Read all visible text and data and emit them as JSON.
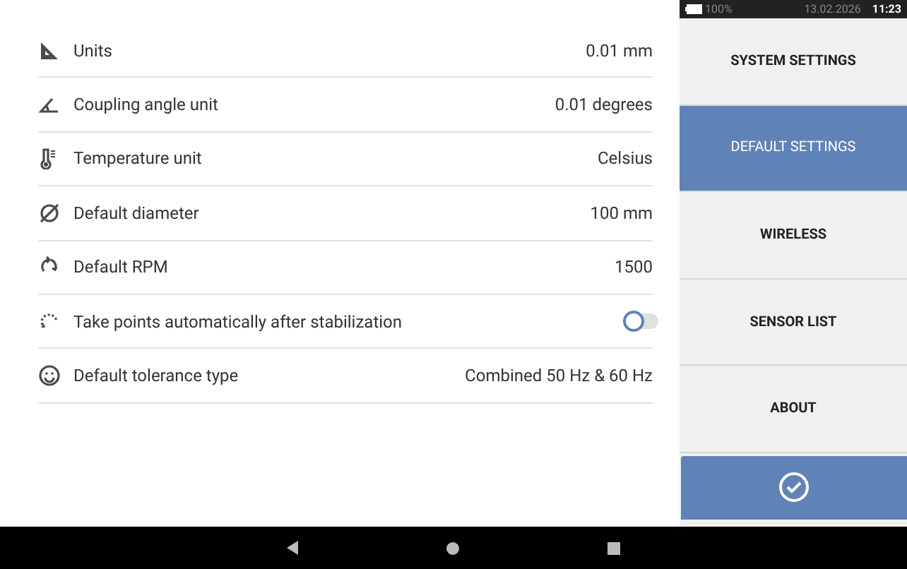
{
  "settings": [
    {
      "kind": "value",
      "label": "Units",
      "value": "0.01 mm"
    },
    {
      "kind": "value",
      "label": "Coupling angle unit",
      "value": "0.01 degrees"
    },
    {
      "kind": "value",
      "label": "Temperature unit",
      "value": "Celsius"
    },
    {
      "kind": "value",
      "label": "Default diameter",
      "value": "100 mm"
    },
    {
      "kind": "value",
      "label": "Default RPM",
      "value": "1500"
    },
    {
      "kind": "toggle",
      "label": "Take points automatically after stabilization",
      "on": false
    },
    {
      "kind": "value",
      "label": "Default tolerance type",
      "value": "Combined 50 Hz & 60 Hz"
    }
  ],
  "status_bar": {
    "battery": "100%",
    "date": "13.02.2026",
    "time": "11:23"
  },
  "menu": [
    {
      "label": "SYSTEM SETTINGS",
      "selected": false
    },
    {
      "label": "DEFAULT SETTINGS",
      "selected": true
    },
    {
      "label": "WIRELESS",
      "selected": false
    },
    {
      "label": "SENSOR LIST",
      "selected": false
    },
    {
      "label": "ABOUT",
      "selected": false
    }
  ]
}
